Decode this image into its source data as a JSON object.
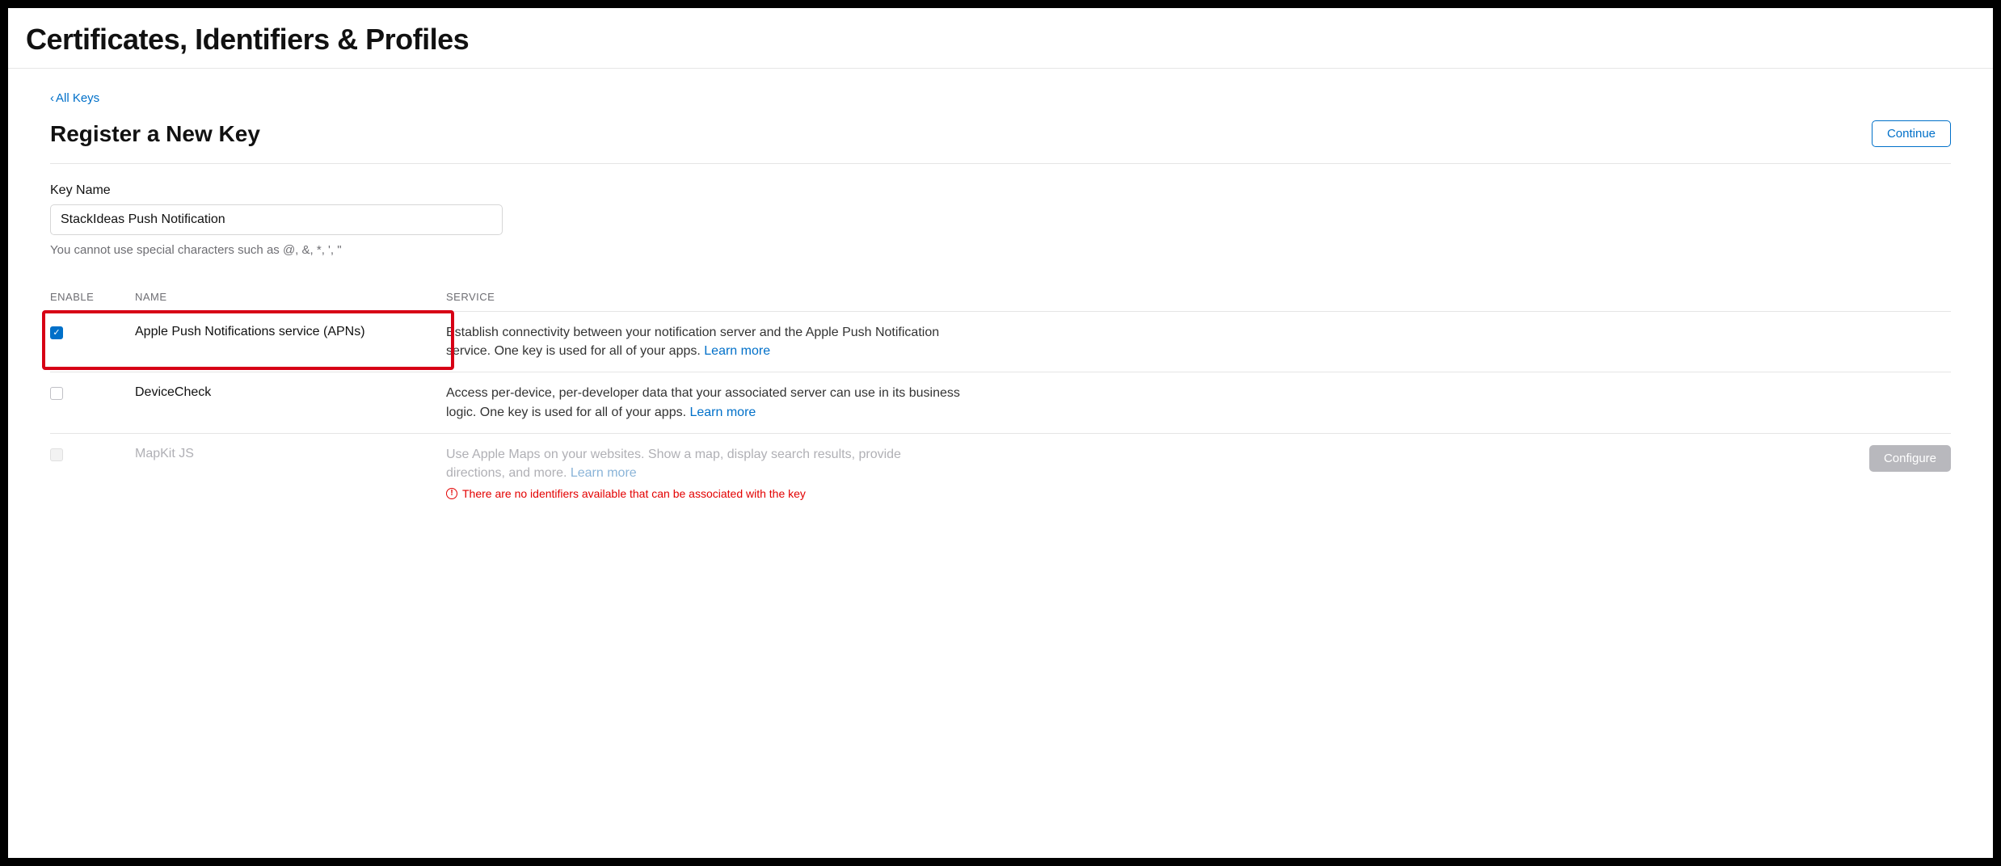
{
  "page": {
    "title": "Certificates, Identifiers & Profiles"
  },
  "nav": {
    "back_label": "All Keys"
  },
  "section": {
    "title": "Register a New Key",
    "continue_label": "Continue"
  },
  "key_name": {
    "label": "Key Name",
    "value": "StackIdeas Push Notification",
    "hint": "You cannot use special characters such as @, &, *, ', \""
  },
  "columns": {
    "enable": "ENABLE",
    "name": "NAME",
    "service": "SERVICE"
  },
  "services": [
    {
      "id": "apns",
      "checked": true,
      "disabled": false,
      "highlight": true,
      "name": "Apple Push Notifications service (APNs)",
      "description": "Establish connectivity between your notification server and the Apple Push Notification service. One key is used for all of your apps.",
      "learn_more": "Learn more"
    },
    {
      "id": "devicecheck",
      "checked": false,
      "disabled": false,
      "highlight": false,
      "name": "DeviceCheck",
      "description": "Access per-device, per-developer data that your associated server can use in its business logic. One key is used for all of your apps.",
      "learn_more": "Learn more"
    },
    {
      "id": "mapkitjs",
      "checked": false,
      "disabled": true,
      "highlight": false,
      "name": "MapKit JS",
      "description": "Use Apple Maps on your websites. Show a map, display search results, provide directions, and more.",
      "learn_more": "Learn more",
      "warning": "There are no identifiers available that can be associated with the key",
      "action_label": "Configure"
    }
  ]
}
